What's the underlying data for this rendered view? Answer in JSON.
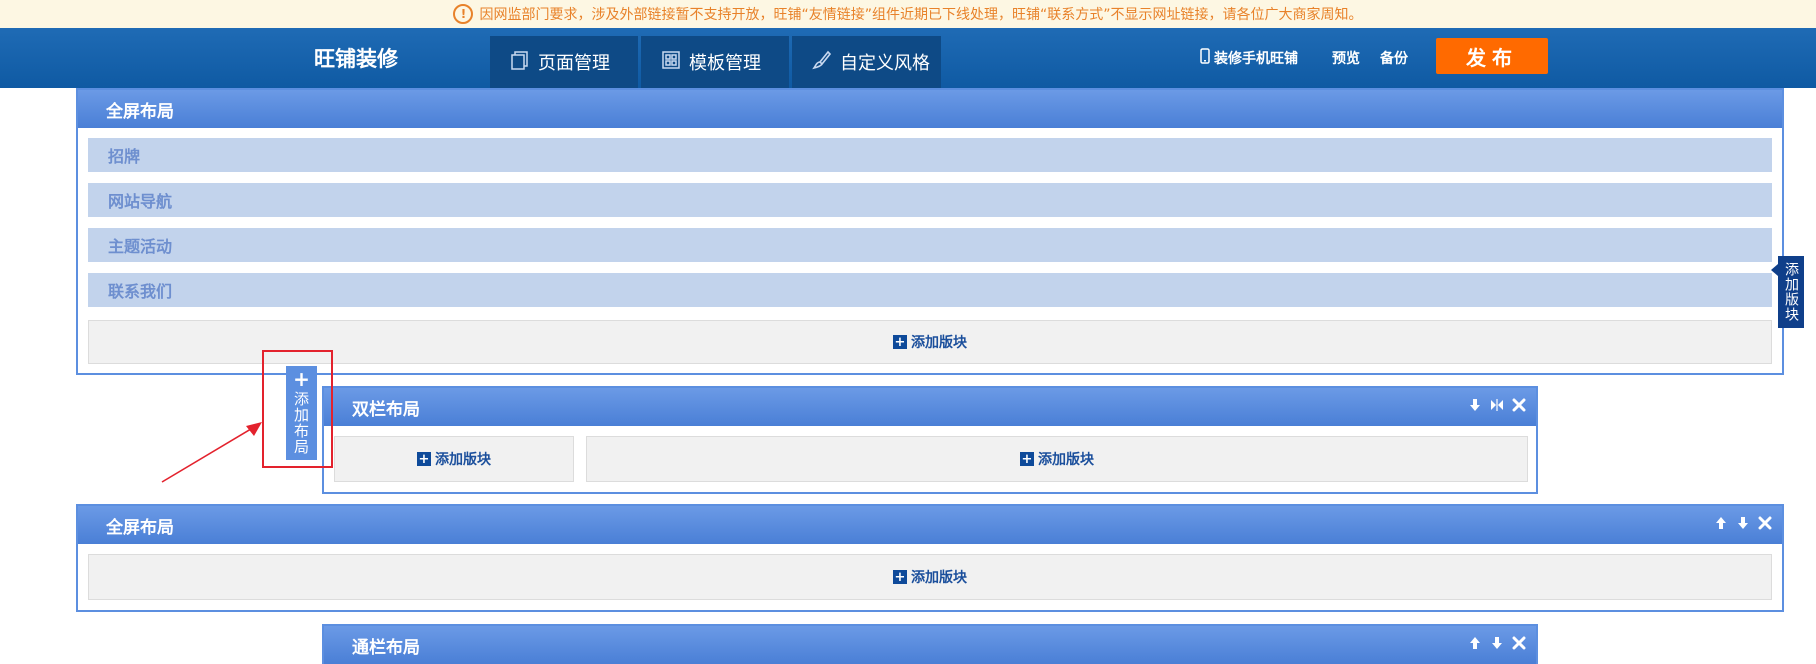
{
  "notice": {
    "text": "因网监部门要求，涉及外部链接暂不支持开放，旺铺“友情链接”组件近期已下线处理，旺铺“联系方式”不显示网址链接，请各位广大商家周知。",
    "icon": "!"
  },
  "header": {
    "brand": "旺铺装修",
    "tabs": [
      {
        "label": "页面管理",
        "icon": "pages-icon"
      },
      {
        "label": "模板管理",
        "icon": "grid-icon"
      },
      {
        "label": "自定义风格",
        "icon": "brush-icon"
      }
    ],
    "mobile_label": "装修手机旺铺",
    "preview_label": "预览",
    "backup_label": "备份",
    "publish_label": "发布"
  },
  "layouts": [
    {
      "title": "全屏布局",
      "rows": [
        "招牌",
        "网站导航",
        "主题活动",
        "联系我们"
      ],
      "add_label": "添加版块"
    },
    {
      "title": "双栏布局",
      "add_left": "添加版块",
      "add_right": "添加版块"
    },
    {
      "title": "全屏布局",
      "add_label": "添加版块"
    },
    {
      "title": "通栏布局"
    }
  ],
  "side_add_label": "添加版块",
  "add_layout_label": "添加布局",
  "colors": {
    "accent": "#5c8fe0",
    "header": "#1762ac",
    "publish": "#ff6a00",
    "annotation": "#e3222d"
  }
}
